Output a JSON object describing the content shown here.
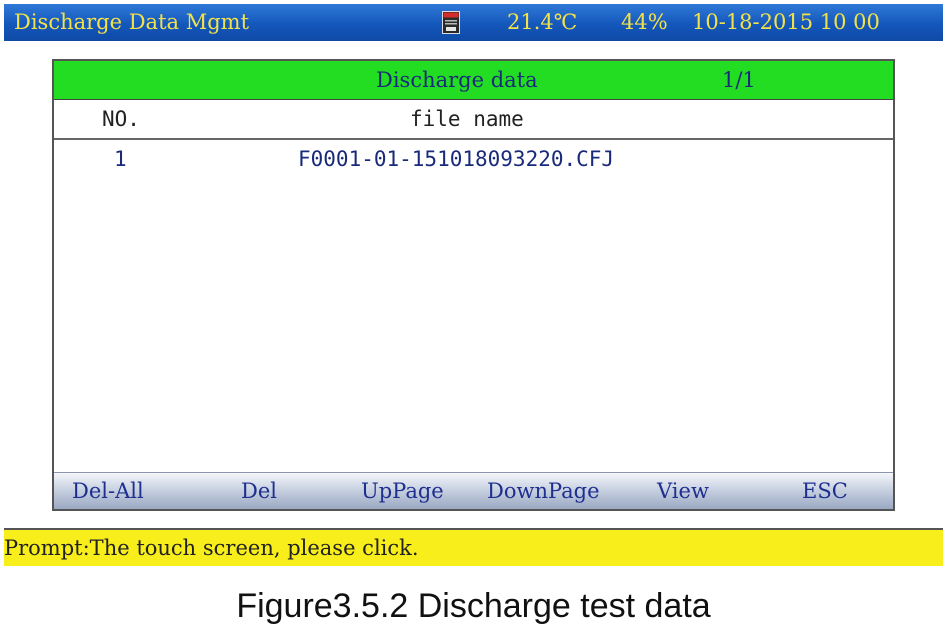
{
  "status_bar": {
    "title": "Discharge Data Mgmt",
    "sd_icon": "sd-card-icon",
    "temperature": "21.4℃",
    "battery": "44%",
    "datetime": "10-18-2015 10 00"
  },
  "panel": {
    "header_title": "Discharge data",
    "page_indicator": "1/1",
    "columns": {
      "no": "NO.",
      "file_name": "file name"
    },
    "rows": [
      {
        "no": "1",
        "file_name": "F0001-01-151018093220.CFJ"
      }
    ]
  },
  "buttons": {
    "del_all": "Del-All",
    "del": "Del",
    "up_page": "UpPage",
    "down_page": "DownPage",
    "view": "View",
    "esc": "ESC"
  },
  "prompt": "Prompt:The touch screen, please click.",
  "caption": "Figure3.5.2 Discharge test data",
  "colors": {
    "status_bar_bg": "#1457bb",
    "status_text": "#f2e24a",
    "panel_header_bg": "#22dd22",
    "prompt_bg": "#f8ee1c",
    "button_text": "#1f2f8f"
  }
}
